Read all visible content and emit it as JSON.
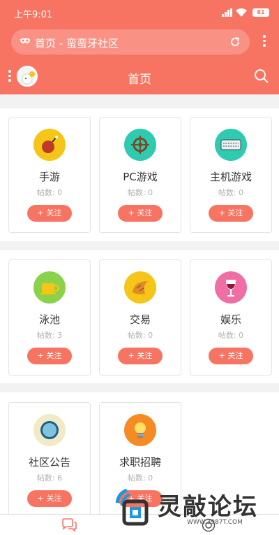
{
  "status_bar": {
    "time": "上午9:01",
    "battery": "81"
  },
  "browser": {
    "url_text": "首页 - 蛮蛮牙社区"
  },
  "header": {
    "title": "首页"
  },
  "forums": [
    {
      "name": "手游",
      "count": "帖数: 0",
      "follow": "+ 关注",
      "icon": "bomb-icon",
      "color": "#f5c518"
    },
    {
      "name": "PC游戏",
      "count": "帖数: 0",
      "follow": "+ 关注",
      "icon": "ship-wheel-icon",
      "color": "#2ecbb0"
    },
    {
      "name": "主机游戏",
      "count": "帖数: 0",
      "follow": "+ 关注",
      "icon": "keyboard-icon",
      "color": "#2ecbb0"
    },
    {
      "name": "泳池",
      "count": "帖数: 3",
      "follow": "+ 关注",
      "icon": "cup-icon",
      "color": "#8ad24a"
    },
    {
      "name": "交易",
      "count": "帖数: 0",
      "follow": "+ 关注",
      "icon": "croissant-icon",
      "color": "#f5c518"
    },
    {
      "name": "娱乐",
      "count": "帖数: 0",
      "follow": "+ 关注",
      "icon": "wine-glass-icon",
      "color": "#ef6ea3"
    },
    {
      "name": "社区公告",
      "count": "帖数: 6",
      "follow": "+ 关注",
      "icon": "plate-icon",
      "color": "#f1eac4"
    },
    {
      "name": "求职招聘",
      "count": "帖数: 0",
      "follow": "+ 关注",
      "icon": "lightbulb-icon",
      "color": "#f58b23"
    }
  ],
  "watermark": {
    "text": "灵敲论坛",
    "url": "WWW.3987T.COM"
  },
  "bottom_nav": {
    "tab1_icon": "chat-icon",
    "tab2_icon": "compass-icon"
  }
}
